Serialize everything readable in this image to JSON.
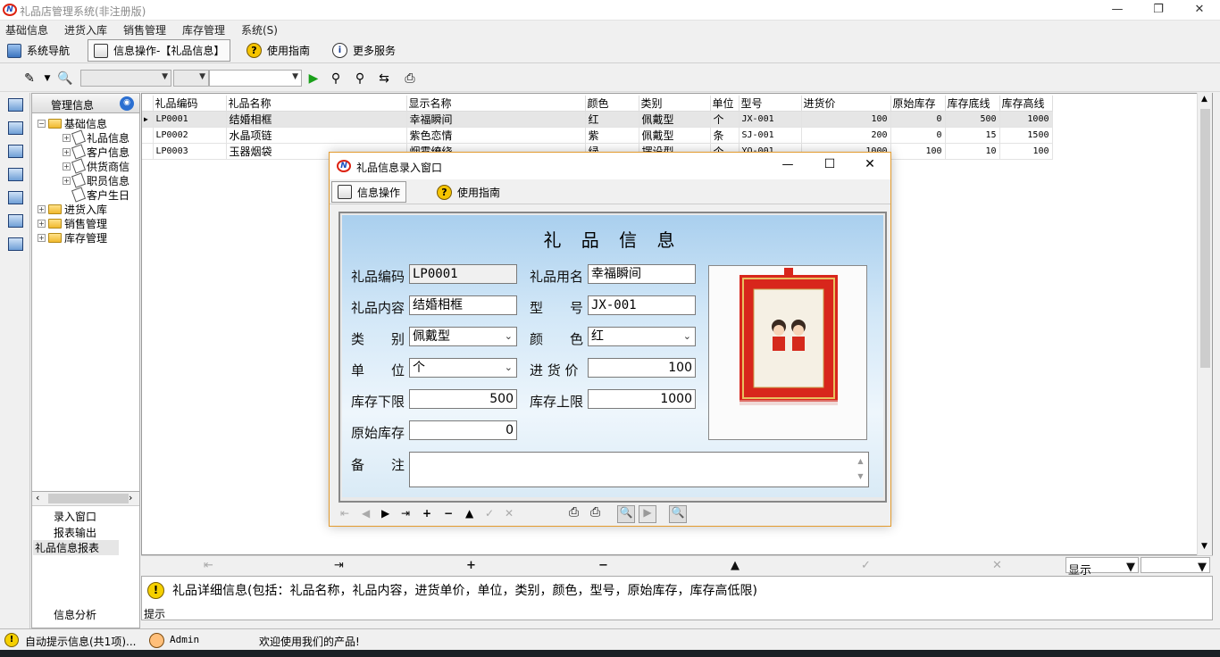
{
  "app": {
    "title": "礼品店管理系统(非注册版)"
  },
  "menu": [
    "基础信息",
    "进货入库",
    "销售管理",
    "库存管理",
    "系统(S)"
  ],
  "tabs": [
    {
      "label": "系统导航"
    },
    {
      "label": "信息操作-【礼品信息】"
    },
    {
      "label": "使用指南"
    },
    {
      "label": "更多服务"
    }
  ],
  "tree": {
    "header": "管理信息",
    "nodes": [
      "基础信息",
      "礼品信息",
      "客户信息",
      "供货商信",
      "职员信息",
      "客户生日",
      "进货入库",
      "销售管理",
      "库存管理"
    ]
  },
  "nav_bottom": {
    "items": [
      "录入窗口",
      "报表输出",
      "礼品信息报表"
    ],
    "footer": "信息分析"
  },
  "grid": {
    "columns": [
      "礼品编码",
      "礼品名称",
      "显示名称",
      "颜色",
      "类别",
      "单位",
      "型号",
      "进货价",
      "原始库存",
      "库存底线",
      "库存高线"
    ],
    "rows": [
      [
        "LP0001",
        "结婚相框",
        "幸福瞬间",
        "红",
        "佩戴型",
        "个",
        "JX-001",
        "100",
        "0",
        "500",
        "1000"
      ],
      [
        "LP0002",
        "水晶项链",
        "紫色恋情",
        "紫",
        "佩戴型",
        "条",
        "SJ-001",
        "200",
        "0",
        "15",
        "1500"
      ],
      [
        "LP0003",
        "玉器烟袋",
        "烟雾缭绕",
        "绿",
        "摆设型",
        "个",
        "YQ-001",
        "1000",
        "100",
        "10",
        "100"
      ]
    ]
  },
  "grid_footer": {
    "display_label": "显示"
  },
  "hint": {
    "label": "提示",
    "text": "礼品详细信息(包括：礼品名称，礼品内容，进货单价，单位，类别，颜色，型号，原始库存，库存高低限)"
  },
  "status": {
    "auto_hint": "自动提示信息(共1项)...",
    "user": "Admin",
    "welcome": "欢迎使用我们的产品!"
  },
  "dialog": {
    "title": "礼品信息录入窗口",
    "tabs": [
      "信息操作",
      "使用指南"
    ],
    "heading": "礼 品 信 息",
    "labels": {
      "code": "礼品编码",
      "use_name": "礼品用名",
      "content": "礼品内容",
      "model": "型　　号",
      "category": "类　　别",
      "color": "颜　　色",
      "unit": "单　　位",
      "price": "进 货 价",
      "min_stock": "库存下限",
      "max_stock": "库存上限",
      "orig_stock": "原始库存",
      "remark": "备　　注"
    },
    "values": {
      "code": "LP0001",
      "use_name": "幸福瞬间",
      "content": "结婚相框",
      "model": "JX-001",
      "category": "佩戴型",
      "color": "红",
      "unit": "个",
      "price": "100",
      "min_stock": "500",
      "max_stock": "1000",
      "orig_stock": "0",
      "remark": ""
    }
  },
  "colors": {
    "accent": "#e39b2e",
    "panel_top": "#a9cfee",
    "frame_red": "#d8261c"
  }
}
